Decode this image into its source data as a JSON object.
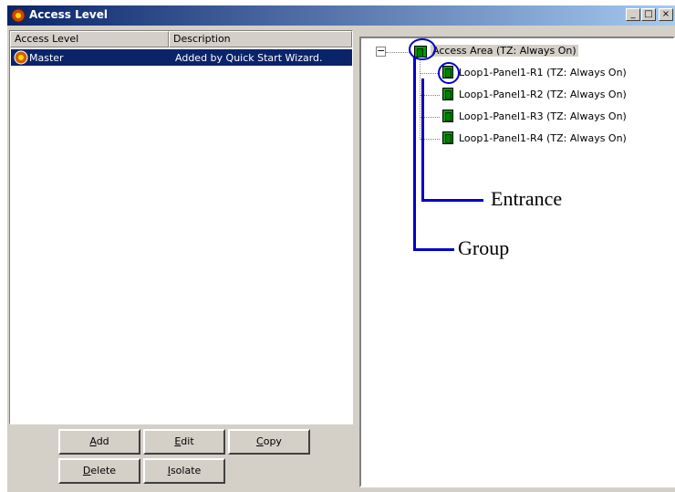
{
  "window": {
    "title": "Access Level",
    "controls": {
      "minimize": "_",
      "maximize": "□",
      "close": "×"
    }
  },
  "list": {
    "columns": [
      "Access Level",
      "Description"
    ],
    "rows": [
      {
        "level": "Master",
        "description": "Added by Quick Start Wizard."
      }
    ]
  },
  "buttons": {
    "add": {
      "key": "A",
      "rest": "dd"
    },
    "edit": {
      "key": "E",
      "rest": "dit"
    },
    "copy": {
      "key": "C",
      "rest": "opy"
    },
    "delete": {
      "key": "D",
      "rest": "elete"
    },
    "isolate": {
      "key": "I",
      "rest": "solate"
    }
  },
  "tree": {
    "root_collapse": "−",
    "root": "Access Area (TZ: Always On)",
    "children": [
      "Loop1-Panel1-R1 (TZ: Always On)",
      "Loop1-Panel1-R2 (TZ: Always On)",
      "Loop1-Panel1-R3 (TZ: Always On)",
      "Loop1-Panel1-R4 (TZ: Always On)"
    ]
  },
  "annotations": {
    "entrance": "Entrance",
    "group": "Group"
  },
  "colors": {
    "title_gradient_start": "#0a246a",
    "title_gradient_end": "#a6caf0",
    "selection": "#0a246a",
    "door_green": "#00a000",
    "annotation_blue": "#0000cc"
  },
  "icons": [
    "app-icon",
    "master-icon",
    "door-icon"
  ]
}
